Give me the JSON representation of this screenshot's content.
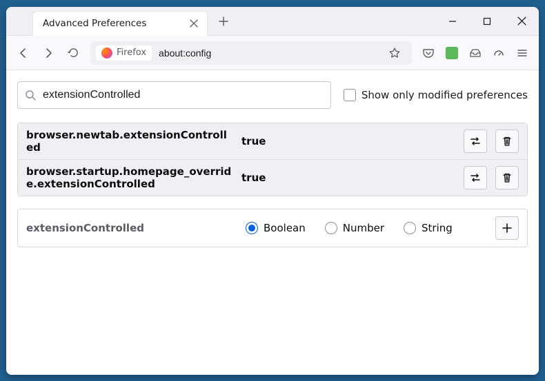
{
  "tab": {
    "title": "Advanced Preferences"
  },
  "urlbar": {
    "identity": "Firefox",
    "url": "about:config"
  },
  "search": {
    "value": "extensionControlled",
    "checkbox_label": "Show only modified preferences"
  },
  "prefs": [
    {
      "name": "browser.newtab.extensionControlled",
      "value": "true"
    },
    {
      "name": "browser.startup.homepage_override.extensionControlled",
      "value": "true"
    }
  ],
  "add": {
    "name": "extensionControlled",
    "types": {
      "boolean": "Boolean",
      "number": "Number",
      "string": "String"
    }
  }
}
